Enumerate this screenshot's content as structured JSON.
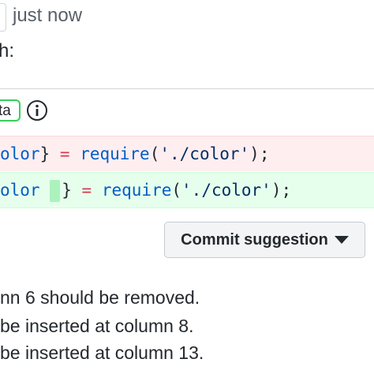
{
  "header": {
    "timestamp": "just now",
    "branch_label": "h:"
  },
  "suggestion": {
    "badge": "ta",
    "removed_code": {
      "pre": "olor",
      "close": "}",
      "op": "=",
      "fn": "require",
      "open_paren": "(",
      "str": "'./color'",
      "close_paren": ");"
    },
    "added_code": {
      "pre": "olor",
      "close": "}",
      "op": "=",
      "fn": "require",
      "open_paren": "(",
      "str": "'./color'",
      "close_paren": ");"
    },
    "commit_button_label": "Commit suggestion"
  },
  "lint_messages": [
    "nn 6 should be removed.",
    "be inserted at column 8.",
    "be inserted at column 13."
  ],
  "colors": {
    "removed_bg": "#ffeef0",
    "added_bg": "#e6ffed",
    "inserted_highlight": "#acf2bd",
    "badge_border": "#34d058"
  }
}
